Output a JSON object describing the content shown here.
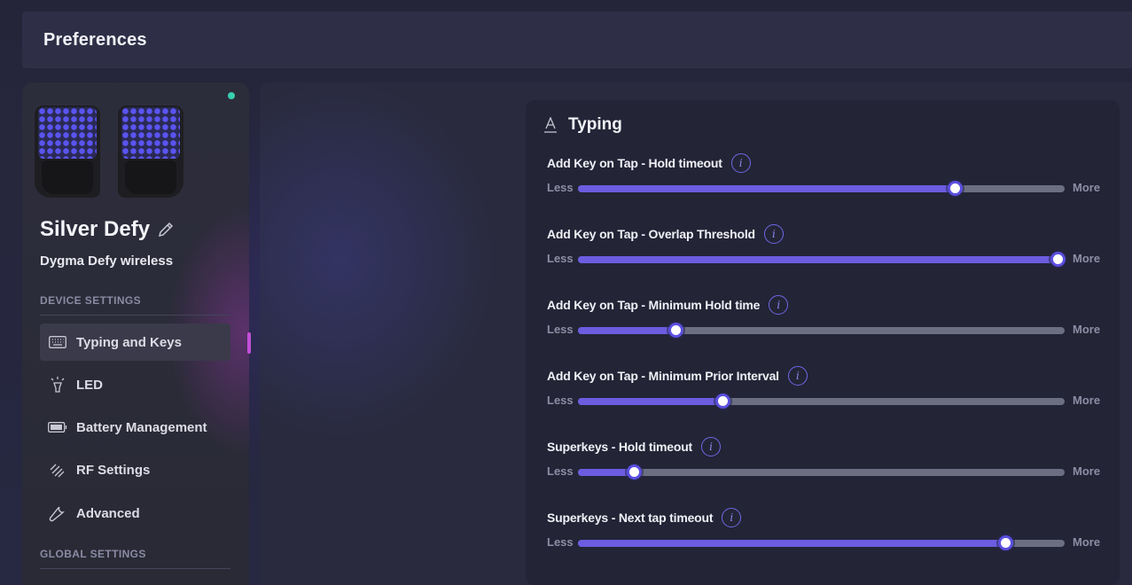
{
  "header": {
    "title": "Preferences"
  },
  "device": {
    "name": "Silver Defy",
    "model": "Dygma Defy wireless",
    "status_color": "#38d0b0"
  },
  "sidebar": {
    "device_settings_label": "DEVICE SETTINGS",
    "global_settings_label": "GLOBAL SETTINGS",
    "items": [
      {
        "label": "Typing and Keys",
        "icon": "keyboard-icon",
        "active": true
      },
      {
        "label": "LED",
        "icon": "led-lamp-icon",
        "active": false
      },
      {
        "label": "Battery Management",
        "icon": "battery-icon",
        "active": false
      },
      {
        "label": "RF Settings",
        "icon": "rf-signal-icon",
        "active": false
      },
      {
        "label": "Advanced",
        "icon": "wrench-icon",
        "active": false
      }
    ]
  },
  "typing": {
    "title": "Typing",
    "less_label": "Less",
    "more_label": "More",
    "settings": [
      {
        "label": "Add Key on Tap - Hold timeout",
        "value": 0.775
      },
      {
        "label": "Add Key on Tap - Overlap Threshold",
        "value": 0.985
      },
      {
        "label": "Add Key on Tap - Minimum Hold time",
        "value": 0.2
      },
      {
        "label": "Add Key on Tap - Minimum Prior Interval",
        "value": 0.297
      },
      {
        "label": "Superkeys - Hold timeout",
        "value": 0.115
      },
      {
        "label": "Superkeys - Next tap timeout",
        "value": 0.878
      }
    ]
  },
  "colors": {
    "accent": "#6c5ce0",
    "active_marker": "#c24fd8"
  }
}
